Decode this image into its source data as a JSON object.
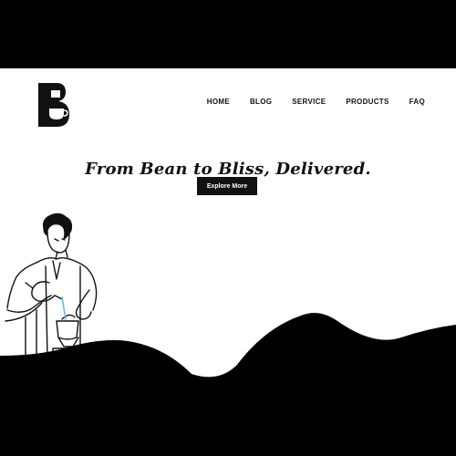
{
  "brand": {
    "logo_icon": "B-coffee-cup-logo",
    "color": "#111111"
  },
  "nav": {
    "items": [
      {
        "label": "HOME"
      },
      {
        "label": "BLOG"
      },
      {
        "label": "SERVICE"
      },
      {
        "label": "PRODUCTS"
      },
      {
        "label": "FAQ"
      }
    ]
  },
  "hero": {
    "title": "From Bean to Bliss, Delivered.",
    "cta_label": "Explore More",
    "illustration": "barista-pour-over-illustration",
    "accent": "#6fb6e8"
  },
  "colors": {
    "background": "#000000",
    "page": "#ffffff",
    "text": "#111111"
  }
}
